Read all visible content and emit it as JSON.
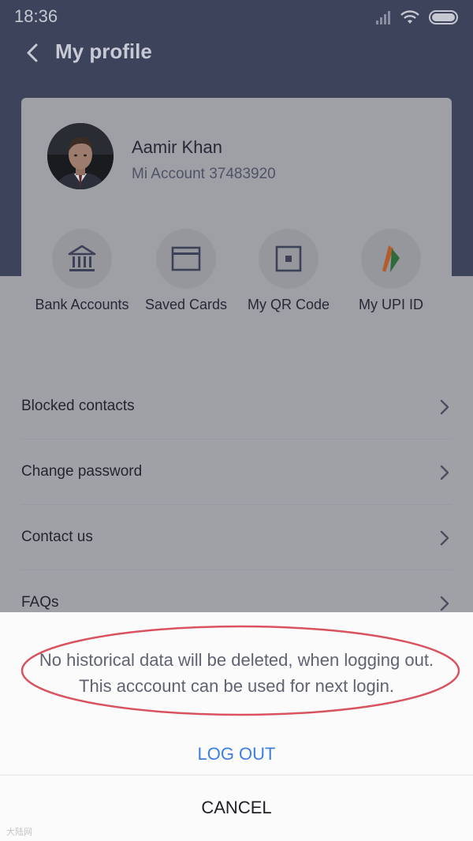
{
  "status_bar": {
    "time": "18:36",
    "icons": [
      "signal-icon",
      "wifi-icon",
      "battery-icon"
    ]
  },
  "header": {
    "title": "My profile",
    "back_icon": "chevron-left-icon"
  },
  "profile": {
    "name": "Aamir Khan",
    "account": "Mi Account 37483920"
  },
  "quick_actions": [
    {
      "label": "Bank Accounts",
      "icon": "bank-icon"
    },
    {
      "label": "Saved Cards",
      "icon": "card-icon"
    },
    {
      "label": "My QR Code",
      "icon": "qr-code-icon"
    },
    {
      "label": "My UPI ID",
      "icon": "upi-icon"
    }
  ],
  "menu": [
    {
      "label": "Blocked contacts"
    },
    {
      "label": "Change password"
    },
    {
      "label": "Contact us"
    },
    {
      "label": "FAQs"
    }
  ],
  "dialog": {
    "message": "No historical data will be deleted, when logging out. This acccount can be used for next login.",
    "logout_label": "LOG OUT",
    "cancel_label": "CANCEL"
  },
  "watermark": "大陆网",
  "colors": {
    "header_bg": "#3e435c",
    "overlay_bg": "#a0a1a7",
    "logout_text": "#3d7fe0",
    "annotation_ellipse": "#d9535f"
  }
}
